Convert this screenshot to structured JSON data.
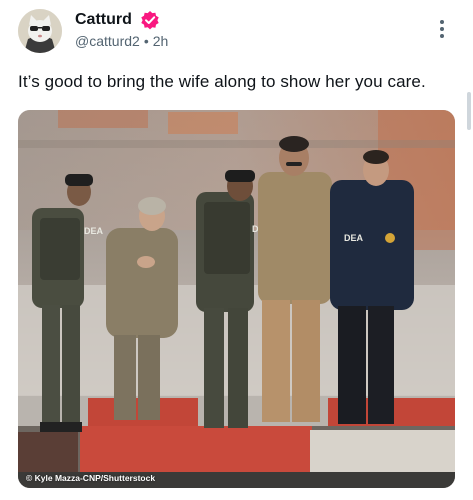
{
  "post": {
    "author": {
      "display_name": "Catturd",
      "handle": "@catturd2",
      "separator": "•",
      "time": "2h",
      "verified_icon": "verified-badge-icon",
      "verified_color": "#f91880"
    },
    "text": "It’s good to bring the wife along to show her you care.",
    "media": {
      "credit": "© Kyle Mazza-CNP/Shutterstock",
      "vest_text": "DEA",
      "jacket_text": "DEA"
    },
    "more_icon": "more-vertical-icon"
  },
  "colors": {
    "text_primary": "#0f1419",
    "text_secondary": "#536471"
  }
}
